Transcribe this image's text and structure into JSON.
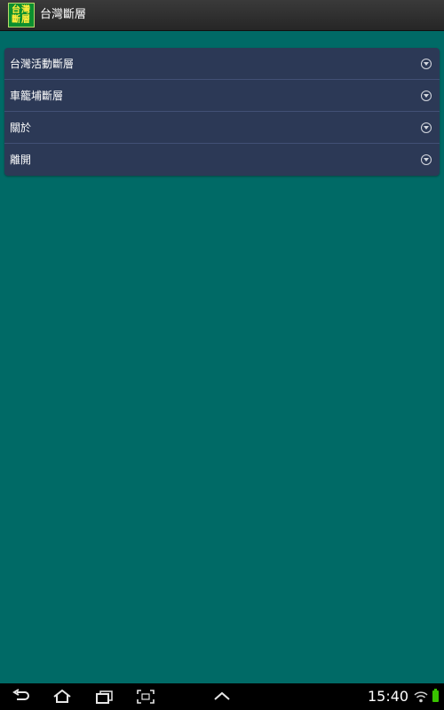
{
  "app": {
    "logo_line1": "台灣",
    "logo_line2": "斷層",
    "title": "台灣斷層"
  },
  "menu": {
    "items": [
      {
        "label": "台灣活動斷層",
        "icon": "chevron-down-circle-icon"
      },
      {
        "label": "車籠埔斷層",
        "icon": "chevron-down-circle-icon"
      },
      {
        "label": "關於",
        "icon": "chevron-down-circle-icon"
      },
      {
        "label": "離開",
        "icon": "chevron-down-circle-icon"
      }
    ]
  },
  "status_bar": {
    "time": "15:40",
    "icons": [
      "back-icon",
      "home-icon",
      "recent-apps-icon",
      "screenshot-icon",
      "up-caret-icon",
      "wifi-icon",
      "battery-icon"
    ]
  },
  "colors": {
    "background": "#006a66",
    "titlebar": "#2e2e2e",
    "menu_bg": "#2c3956",
    "menu_divider": "#425075",
    "logo_bg": "#0b8f2f",
    "logo_text": "#ffeb3b",
    "battery": "#39c400"
  }
}
